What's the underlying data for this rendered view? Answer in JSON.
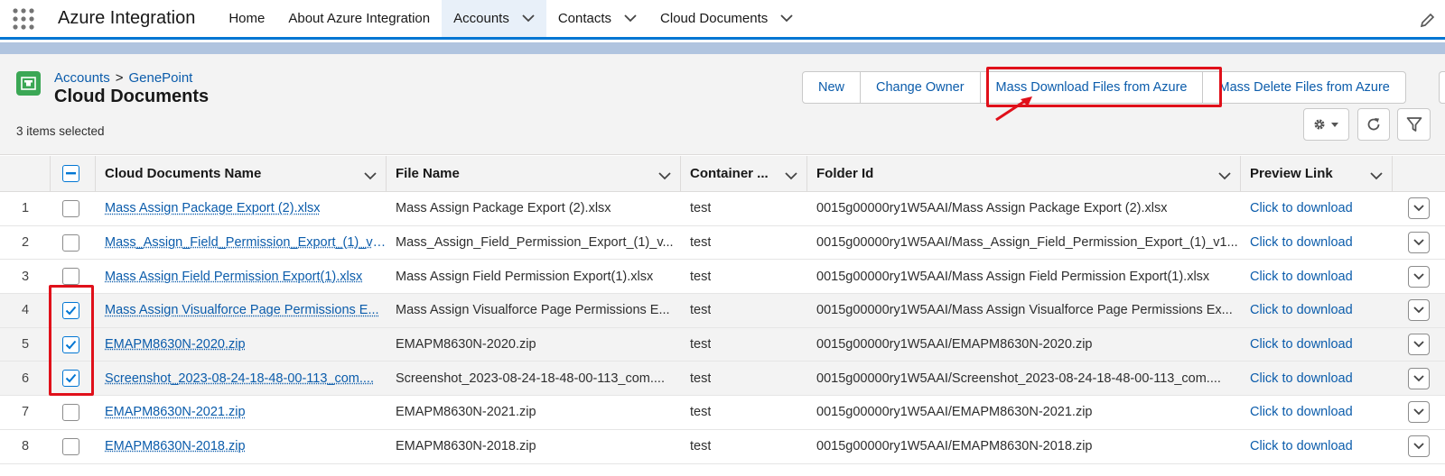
{
  "topnav": {
    "app_name": "Azure Integration",
    "items": [
      {
        "label": "Home",
        "has_menu": false
      },
      {
        "label": "About Azure Integration",
        "has_menu": false
      },
      {
        "label": "Accounts",
        "has_menu": true
      },
      {
        "label": "Contacts",
        "has_menu": true
      },
      {
        "label": "Cloud Documents",
        "has_menu": true
      }
    ],
    "active_item": "Accounts"
  },
  "header": {
    "breadcrumb": [
      "Accounts",
      "GenePoint"
    ],
    "breadcrumb_separator": ">",
    "title": "Cloud Documents",
    "selected_count": "3 items selected",
    "buttons": {
      "new": "New",
      "change_owner": "Change Owner",
      "mass_download": "Mass Download Files from Azure",
      "mass_delete": "Mass Delete Files from Azure"
    },
    "icons": [
      "gear-icon",
      "refresh-icon",
      "filter-icon"
    ]
  },
  "table": {
    "columns": {
      "name": "Cloud Documents Name",
      "file": "File Name",
      "container": "Container ...",
      "folder": "Folder Id",
      "preview": "Preview Link"
    },
    "rows": [
      {
        "num": "1",
        "checked": false,
        "name": "Mass Assign Package Export (2).xlsx",
        "file": "Mass Assign Package Export (2).xlsx",
        "container": "test",
        "folder": "0015g00000ry1W5AAI/Mass Assign Package Export (2).xlsx",
        "preview": "Click to download"
      },
      {
        "num": "2",
        "checked": false,
        "name": "Mass_Assign_Field_Permission_Export_(1)_v1...",
        "file": "Mass_Assign_Field_Permission_Export_(1)_v...",
        "container": "test",
        "folder": "0015g00000ry1W5AAI/Mass_Assign_Field_Permission_Export_(1)_v1...",
        "preview": "Click to download"
      },
      {
        "num": "3",
        "checked": false,
        "name": "Mass Assign Field Permission Export(1).xlsx",
        "file": "Mass Assign Field Permission Export(1).xlsx",
        "container": "test",
        "folder": "0015g00000ry1W5AAI/Mass Assign Field Permission Export(1).xlsx",
        "preview": "Click to download"
      },
      {
        "num": "4",
        "checked": true,
        "name": "Mass Assign Visualforce Page Permissions E...",
        "file": "Mass Assign Visualforce Page Permissions E...",
        "container": "test",
        "folder": "0015g00000ry1W5AAI/Mass Assign Visualforce Page Permissions Ex...",
        "preview": "Click to download"
      },
      {
        "num": "5",
        "checked": true,
        "name": "EMAPM8630N-2020.zip",
        "file": "EMAPM8630N-2020.zip",
        "container": "test",
        "folder": "0015g00000ry1W5AAI/EMAPM8630N-2020.zip",
        "preview": "Click to download"
      },
      {
        "num": "6",
        "checked": true,
        "name": "Screenshot_2023-08-24-18-48-00-113_com....",
        "file": "Screenshot_2023-08-24-18-48-00-113_com....",
        "container": "test",
        "folder": "0015g00000ry1W5AAI/Screenshot_2023-08-24-18-48-00-113_com....",
        "preview": "Click to download"
      },
      {
        "num": "7",
        "checked": false,
        "name": "EMAPM8630N-2021.zip",
        "file": "EMAPM8630N-2021.zip",
        "container": "test",
        "folder": "0015g00000ry1W5AAI/EMAPM8630N-2021.zip",
        "preview": "Click to download"
      },
      {
        "num": "8",
        "checked": false,
        "name": "EMAPM8630N-2018.zip",
        "file": "EMAPM8630N-2018.zip",
        "container": "test",
        "folder": "0015g00000ry1W5AAI/EMAPM8630N-2018.zip",
        "preview": "Click to download"
      }
    ]
  },
  "colors": {
    "brand_blue": "#0176d3",
    "link_blue": "#0b5cab",
    "highlight_red": "#e0101a",
    "object_icon_green": "#3ba755"
  }
}
